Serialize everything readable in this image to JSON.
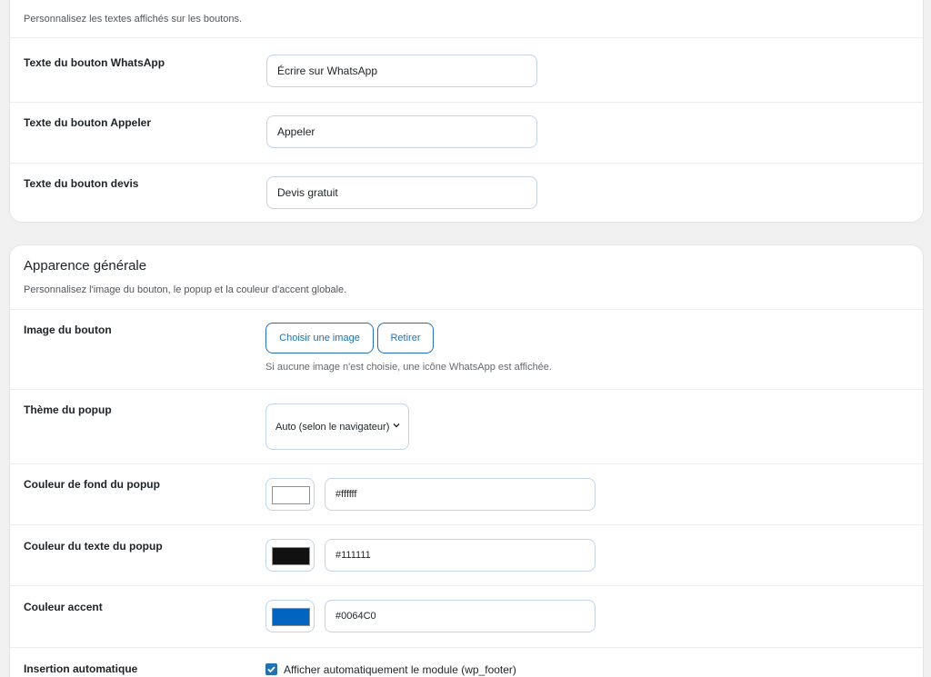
{
  "buttons_card": {
    "description": "Personnalisez les textes affichés sur les boutons.",
    "rows": [
      {
        "label": "Texte du bouton WhatsApp",
        "value": "Écrire sur WhatsApp"
      },
      {
        "label": "Texte du bouton Appeler",
        "value": "Appeler"
      },
      {
        "label": "Texte du bouton devis",
        "value": "Devis gratuit"
      }
    ]
  },
  "appearance_card": {
    "title": "Apparence générale",
    "description": "Personnalisez l'image du bouton, le popup et la couleur d'accent globale.",
    "image_row": {
      "label": "Image du bouton",
      "choose_button": "Choisir une image",
      "remove_button": "Retirer",
      "help": "Si aucune image n'est choisie, une icône WhatsApp est affichée."
    },
    "theme_row": {
      "label": "Thème du popup",
      "selected": "Auto (selon le navigateur)",
      "icon": "chevron-down-icon"
    },
    "bg_color_row": {
      "label": "Couleur de fond du popup",
      "value": "#ffffff",
      "swatch": "#ffffff"
    },
    "text_color_row": {
      "label": "Couleur du texte du popup",
      "value": "#111111",
      "swatch": "#111111"
    },
    "accent_row": {
      "label": "Couleur accent",
      "value": "#0064C0",
      "swatch": "#0064c0"
    },
    "auto_insert_row": {
      "label": "Insertion automatique",
      "checkbox_label": "Afficher automatiquement le module (wp_footer)",
      "checked": true
    }
  },
  "colors": {
    "accent": "#2271b1",
    "page_background": "#f0f0f1"
  }
}
